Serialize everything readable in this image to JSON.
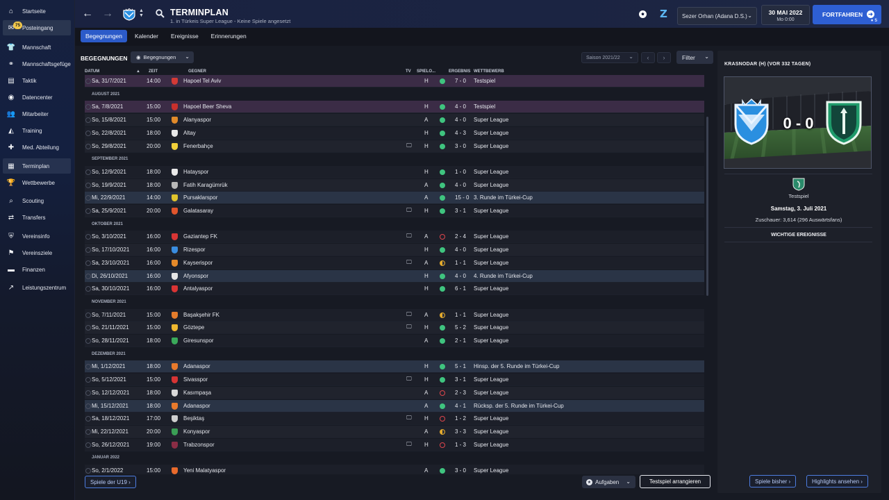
{
  "sidebar": {
    "items": [
      {
        "label": "Startseite",
        "icon": "home-icon",
        "glyph": "⌂"
      },
      {
        "label": "Posteingang",
        "icon": "inbox-icon",
        "glyph": "✉",
        "badge": "75"
      },
      {
        "label": "Mannschaft",
        "icon": "shirt-icon",
        "glyph": "👕"
      },
      {
        "label": "Mannschaftsgefüge",
        "icon": "team-dynamics-icon",
        "glyph": "⚭"
      },
      {
        "label": "Taktik",
        "icon": "tactics-icon",
        "glyph": "▤"
      },
      {
        "label": "Datencenter",
        "icon": "data-center-icon",
        "glyph": "◉"
      },
      {
        "label": "Mitarbeiter",
        "icon": "staff-icon",
        "glyph": "👥"
      },
      {
        "label": "Training",
        "icon": "training-icon",
        "glyph": "◭"
      },
      {
        "label": "Med. Abteilung",
        "icon": "medical-icon",
        "glyph": "✚"
      },
      {
        "label": "Terminplan",
        "icon": "calendar-icon",
        "glyph": "▦"
      },
      {
        "label": "Wettbewerbe",
        "icon": "trophy-icon",
        "glyph": "🏆"
      },
      {
        "label": "Scouting",
        "icon": "scouting-icon",
        "glyph": "⌕"
      },
      {
        "label": "Transfers",
        "icon": "transfers-icon",
        "glyph": "⇄"
      },
      {
        "label": "Vereinsinfo",
        "icon": "club-info-icon",
        "glyph": "⛨"
      },
      {
        "label": "Vereinsziele",
        "icon": "club-vision-icon",
        "glyph": "⚑"
      },
      {
        "label": "Finanzen",
        "icon": "finances-icon",
        "glyph": "▬"
      },
      {
        "label": "Leistungszentrum",
        "icon": "development-centre-icon",
        "glyph": "↗"
      }
    ]
  },
  "header": {
    "title": "TERMINPLAN",
    "subtitle": "1. in Türkeis Super League - Keine Spiele angesetzt",
    "manager": "Sezer Orhan (Adana D.S.)",
    "date": "30 MAI 2022",
    "day": "Mo 0:00",
    "continue_label": "FORTFAHREN",
    "continue_count": "5"
  },
  "tabs": [
    {
      "label": "Begegnungen",
      "active": true
    },
    {
      "label": "Kalender",
      "active": false
    },
    {
      "label": "Ereignisse",
      "active": false
    },
    {
      "label": "Erinnerungen",
      "active": false
    }
  ],
  "toolbar": {
    "section_title": "BEGEGNUNGEN",
    "view_label": "Begegnungen",
    "season_label": "Saison 2021/22",
    "filter_label": "Filter"
  },
  "columns": {
    "date": "DATUM",
    "time": "ZEIT",
    "opponent": "GEGNER",
    "tv": "TV",
    "venue": "SPIELO...",
    "result": "ERGEBNIS",
    "competition": "WETTBEWERB"
  },
  "rows": [
    {
      "type": "match",
      "date": "Sa, 31/7/2021",
      "time": "14:00",
      "opponent": "Hapoel Tel Aviv",
      "crest": "#d33a36",
      "tv": false,
      "venue": "H",
      "result": "win",
      "score": "7 - 0",
      "competition": "Testspiel",
      "style": "highlight"
    },
    {
      "type": "month",
      "label": "AUGUST 2021"
    },
    {
      "type": "match",
      "date": "Sa, 7/8/2021",
      "time": "15:00",
      "opponent": "Hapoel Beer Sheva",
      "crest": "#c9302c",
      "tv": false,
      "venue": "H",
      "result": "win",
      "score": "4 - 0",
      "competition": "Testspiel",
      "style": "highlight"
    },
    {
      "type": "match",
      "date": "So, 15/8/2021",
      "time": "15:00",
      "opponent": "Alanyaspor",
      "crest": "#e08a2a",
      "tv": false,
      "venue": "A",
      "result": "win",
      "score": "4 - 0",
      "competition": "Super League",
      "style": "alt"
    },
    {
      "type": "match",
      "date": "So, 22/8/2021",
      "time": "18:00",
      "opponent": "Altay",
      "crest": "#e8e8e8",
      "tv": false,
      "venue": "H",
      "result": "win",
      "score": "4 - 3",
      "competition": "Super League",
      "style": ""
    },
    {
      "type": "match",
      "date": "So, 29/8/2021",
      "time": "20:00",
      "opponent": "Fenerbahçe",
      "crest": "#f1d03a",
      "tv": true,
      "venue": "H",
      "result": "win",
      "score": "3 - 0",
      "competition": "Super League",
      "style": "alt"
    },
    {
      "type": "month",
      "label": "SEPTEMBER 2021"
    },
    {
      "type": "match",
      "date": "So, 12/9/2021",
      "time": "18:00",
      "opponent": "Hatayspor",
      "crest": "#e9e9e9",
      "tv": false,
      "venue": "H",
      "result": "win",
      "score": "1 - 0",
      "competition": "Super League",
      "style": ""
    },
    {
      "type": "match",
      "date": "So, 19/9/2021",
      "time": "18:00",
      "opponent": "Fatih Karagümrük",
      "crest": "#b8b8b8",
      "tv": false,
      "venue": "A",
      "result": "win",
      "score": "4 - 0",
      "competition": "Super League",
      "style": "alt"
    },
    {
      "type": "match",
      "date": "Mi, 22/9/2021",
      "time": "14:00",
      "opponent": "Pursaklarspor",
      "crest": "#e0c42c",
      "tv": false,
      "venue": "A",
      "result": "win",
      "score": "15 - 0",
      "competition": "3. Runde im Türkei-Cup",
      "style": "cup"
    },
    {
      "type": "match",
      "date": "Sa, 25/9/2021",
      "time": "20:00",
      "opponent": "Galatasaray",
      "crest": "#e0552c",
      "tv": true,
      "venue": "H",
      "result": "win",
      "score": "3 - 1",
      "competition": "Super League",
      "style": ""
    },
    {
      "type": "month",
      "label": "OKTOBER 2021"
    },
    {
      "type": "match",
      "date": "So, 3/10/2021",
      "time": "16:00",
      "opponent": "Gaziantep FK",
      "crest": "#d83535",
      "tv": true,
      "venue": "A",
      "result": "loss",
      "score": "2 - 4",
      "competition": "Super League",
      "style": ""
    },
    {
      "type": "match",
      "date": "So, 17/10/2021",
      "time": "16:00",
      "opponent": "Rizespor",
      "crest": "#3a8de0",
      "tv": false,
      "venue": "H",
      "result": "win",
      "score": "4 - 0",
      "competition": "Super League",
      "style": "alt"
    },
    {
      "type": "match",
      "date": "Sa, 23/10/2021",
      "time": "16:00",
      "opponent": "Kayserispor",
      "crest": "#e58a2a",
      "tv": true,
      "venue": "A",
      "result": "draw",
      "score": "1 - 1",
      "competition": "Super League",
      "style": ""
    },
    {
      "type": "match",
      "date": "Di, 26/10/2021",
      "time": "16:00",
      "opponent": "Afyonspor",
      "crest": "#e5e5e5",
      "tv": false,
      "venue": "H",
      "result": "win",
      "score": "4 - 0",
      "competition": "4. Runde im Türkei-Cup",
      "style": "cup"
    },
    {
      "type": "match",
      "date": "Sa, 30/10/2021",
      "time": "16:00",
      "opponent": "Antalyaspor",
      "crest": "#d93434",
      "tv": false,
      "venue": "H",
      "result": "win",
      "score": "6 - 1",
      "competition": "Super League",
      "style": ""
    },
    {
      "type": "month",
      "label": "NOVEMBER 2021"
    },
    {
      "type": "match",
      "date": "So, 7/11/2021",
      "time": "15:00",
      "opponent": "Başakşehir FK",
      "crest": "#e47c2c",
      "tv": true,
      "venue": "A",
      "result": "draw",
      "score": "1 - 1",
      "competition": "Super League",
      "style": ""
    },
    {
      "type": "match",
      "date": "So, 21/11/2021",
      "time": "15:00",
      "opponent": "Göztepe",
      "crest": "#f0b82f",
      "tv": true,
      "venue": "H",
      "result": "win",
      "score": "5 - 2",
      "competition": "Super League",
      "style": "alt"
    },
    {
      "type": "match",
      "date": "So, 28/11/2021",
      "time": "18:00",
      "opponent": "Giresunspor",
      "crest": "#3aa95a",
      "tv": false,
      "venue": "A",
      "result": "win",
      "score": "2 - 1",
      "competition": "Super League",
      "style": ""
    },
    {
      "type": "month",
      "label": "DEZEMBER 2021"
    },
    {
      "type": "match",
      "date": "Mi, 1/12/2021",
      "time": "18:00",
      "opponent": "Adanaspor",
      "crest": "#e87a2c",
      "tv": false,
      "venue": "H",
      "result": "win",
      "score": "5 - 1",
      "competition": "Hinsp. der 5. Runde im Türkei-Cup",
      "style": "cup"
    },
    {
      "type": "match",
      "date": "So, 5/12/2021",
      "time": "15:00",
      "opponent": "Sivasspor",
      "crest": "#d73434",
      "tv": true,
      "venue": "H",
      "result": "win",
      "score": "3 - 1",
      "competition": "Super League",
      "style": ""
    },
    {
      "type": "match",
      "date": "So, 12/12/2021",
      "time": "18:00",
      "opponent": "Kasımpaşa",
      "crest": "#d9d9d9",
      "tv": false,
      "venue": "A",
      "result": "loss",
      "score": "2 - 3",
      "competition": "Super League",
      "style": "alt"
    },
    {
      "type": "match",
      "date": "Mi, 15/12/2021",
      "time": "18:00",
      "opponent": "Adanaspor",
      "crest": "#e87a2c",
      "tv": false,
      "venue": "A",
      "result": "win",
      "score": "4 - 1",
      "competition": "Rücksp. der 5. Runde im Türkei-Cup",
      "style": "cup"
    },
    {
      "type": "match",
      "date": "Sa, 18/12/2021",
      "time": "17:00",
      "opponent": "Beşiktaş",
      "crest": "#cfcfcf",
      "tv": true,
      "venue": "H",
      "result": "loss",
      "score": "1 - 2",
      "competition": "Super League",
      "style": ""
    },
    {
      "type": "match",
      "date": "Mi, 22/12/2021",
      "time": "20:00",
      "opponent": "Konyaspor",
      "crest": "#3a9e55",
      "tv": false,
      "venue": "A",
      "result": "draw",
      "score": "3 - 3",
      "competition": "Super League",
      "style": "alt"
    },
    {
      "type": "match",
      "date": "So, 26/12/2021",
      "time": "19:00",
      "opponent": "Trabzonspor",
      "crest": "#8a2d45",
      "tv": true,
      "venue": "H",
      "result": "loss",
      "score": "1 - 3",
      "competition": "Super League",
      "style": ""
    },
    {
      "type": "month",
      "label": "JANUAR 2022"
    },
    {
      "type": "match",
      "date": "So, 2/1/2022",
      "time": "15:00",
      "opponent": "Yeni Malatyaspor",
      "crest": "#e86a2c",
      "tv": false,
      "venue": "A",
      "result": "win",
      "score": "3 - 0",
      "competition": "Super League",
      "style": ""
    }
  ],
  "footer": {
    "u19_label": "Spiele der U19",
    "tasks_label": "Aufgaben",
    "arrange_friendly_label": "Testspiel arrangieren"
  },
  "right_panel": {
    "title": "KRASNODAR (H) (VOR 332 TAGEN)",
    "score": "0 - 0",
    "competition": "Testspiel",
    "match_date": "Samstag, 3. Juli 2021",
    "attendance": "Zuschauer: 3,614 (296 Auswärtsfans)",
    "events_title": "WICHTIGE EREIGNISSE",
    "prev_games_label": "Spiele bisher",
    "highlights_label": "Highlights ansehen"
  },
  "colors": {
    "accent": "#2e5fd3",
    "win": "#3fc47f",
    "loss": "#e0464c",
    "draw": "#e3aa2c",
    "home_crest": "#2a8fe0",
    "away_crest": "#1f9a6a"
  }
}
